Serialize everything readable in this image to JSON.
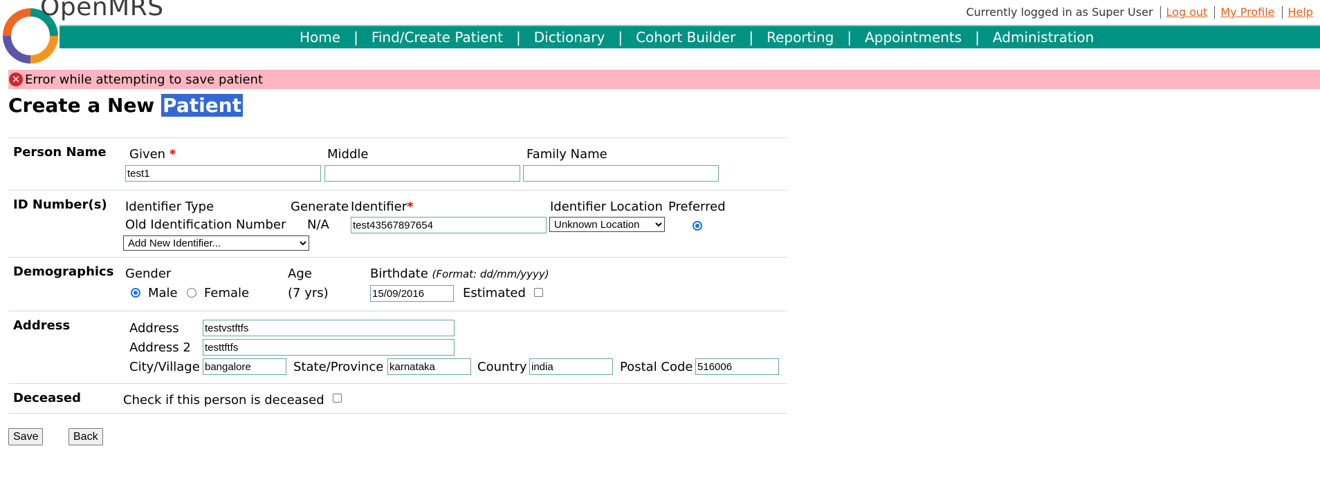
{
  "header": {
    "brand": "OpenMRS",
    "logged_in_text": "Currently logged in as Super User",
    "logout_link": "Log out",
    "profile_link": "My Profile",
    "help_link": "Help",
    "nav": [
      "Home",
      "Find/Create Patient",
      "Dictionary",
      "Cohort Builder",
      "Reporting",
      "Appointments",
      "Administration"
    ]
  },
  "error": {
    "message": "Error while attempting to save patient"
  },
  "title": {
    "prefix": "Create a New ",
    "highlight": "Patient"
  },
  "person_name": {
    "section": "Person Name",
    "given_label": "Given",
    "given_value": "test1",
    "middle_label": "Middle",
    "middle_value": "",
    "family_label": "Family Name",
    "family_value": ""
  },
  "identifiers": {
    "section": "ID Number(s)",
    "col_type": "Identifier Type",
    "col_generate": "Generate",
    "col_identifier": "Identifier",
    "col_location": "Identifier Location",
    "col_preferred": "Preferred",
    "type_value": "Old Identification Number",
    "generate_value": "N/A",
    "identifier_value": "test43567897654",
    "location_value": "Unknown Location",
    "add_new": "Add New Identifier..."
  },
  "demographics": {
    "section": "Demographics",
    "gender_label": "Gender",
    "male": "Male",
    "female": "Female",
    "age_label": "Age",
    "age_value": "(7 yrs)",
    "birthdate_label": "Birthdate",
    "birthdate_format": "(Format: dd/mm/yyyy)",
    "birthdate_value": "15/09/2016",
    "estimated_label": "Estimated"
  },
  "address": {
    "section": "Address",
    "address_label": "Address",
    "address_value": "testvstftfs",
    "address2_label": "Address 2",
    "address2_value": "testtftfs",
    "city_label": "City/Village",
    "city_value": "bangalore",
    "state_label": "State/Province",
    "state_value": "karnataka",
    "country_label": "Country",
    "country_value": "india",
    "postal_label": "Postal Code",
    "postal_value": "516006"
  },
  "deceased": {
    "section": "Deceased",
    "check_label": "Check if this person is deceased"
  },
  "buttons": {
    "save": "Save",
    "back": "Back"
  },
  "colors": {
    "nav_bg": "#009384",
    "error_bg": "#ffb6c1",
    "link": "#e2621b",
    "highlight": "#3367d6"
  }
}
